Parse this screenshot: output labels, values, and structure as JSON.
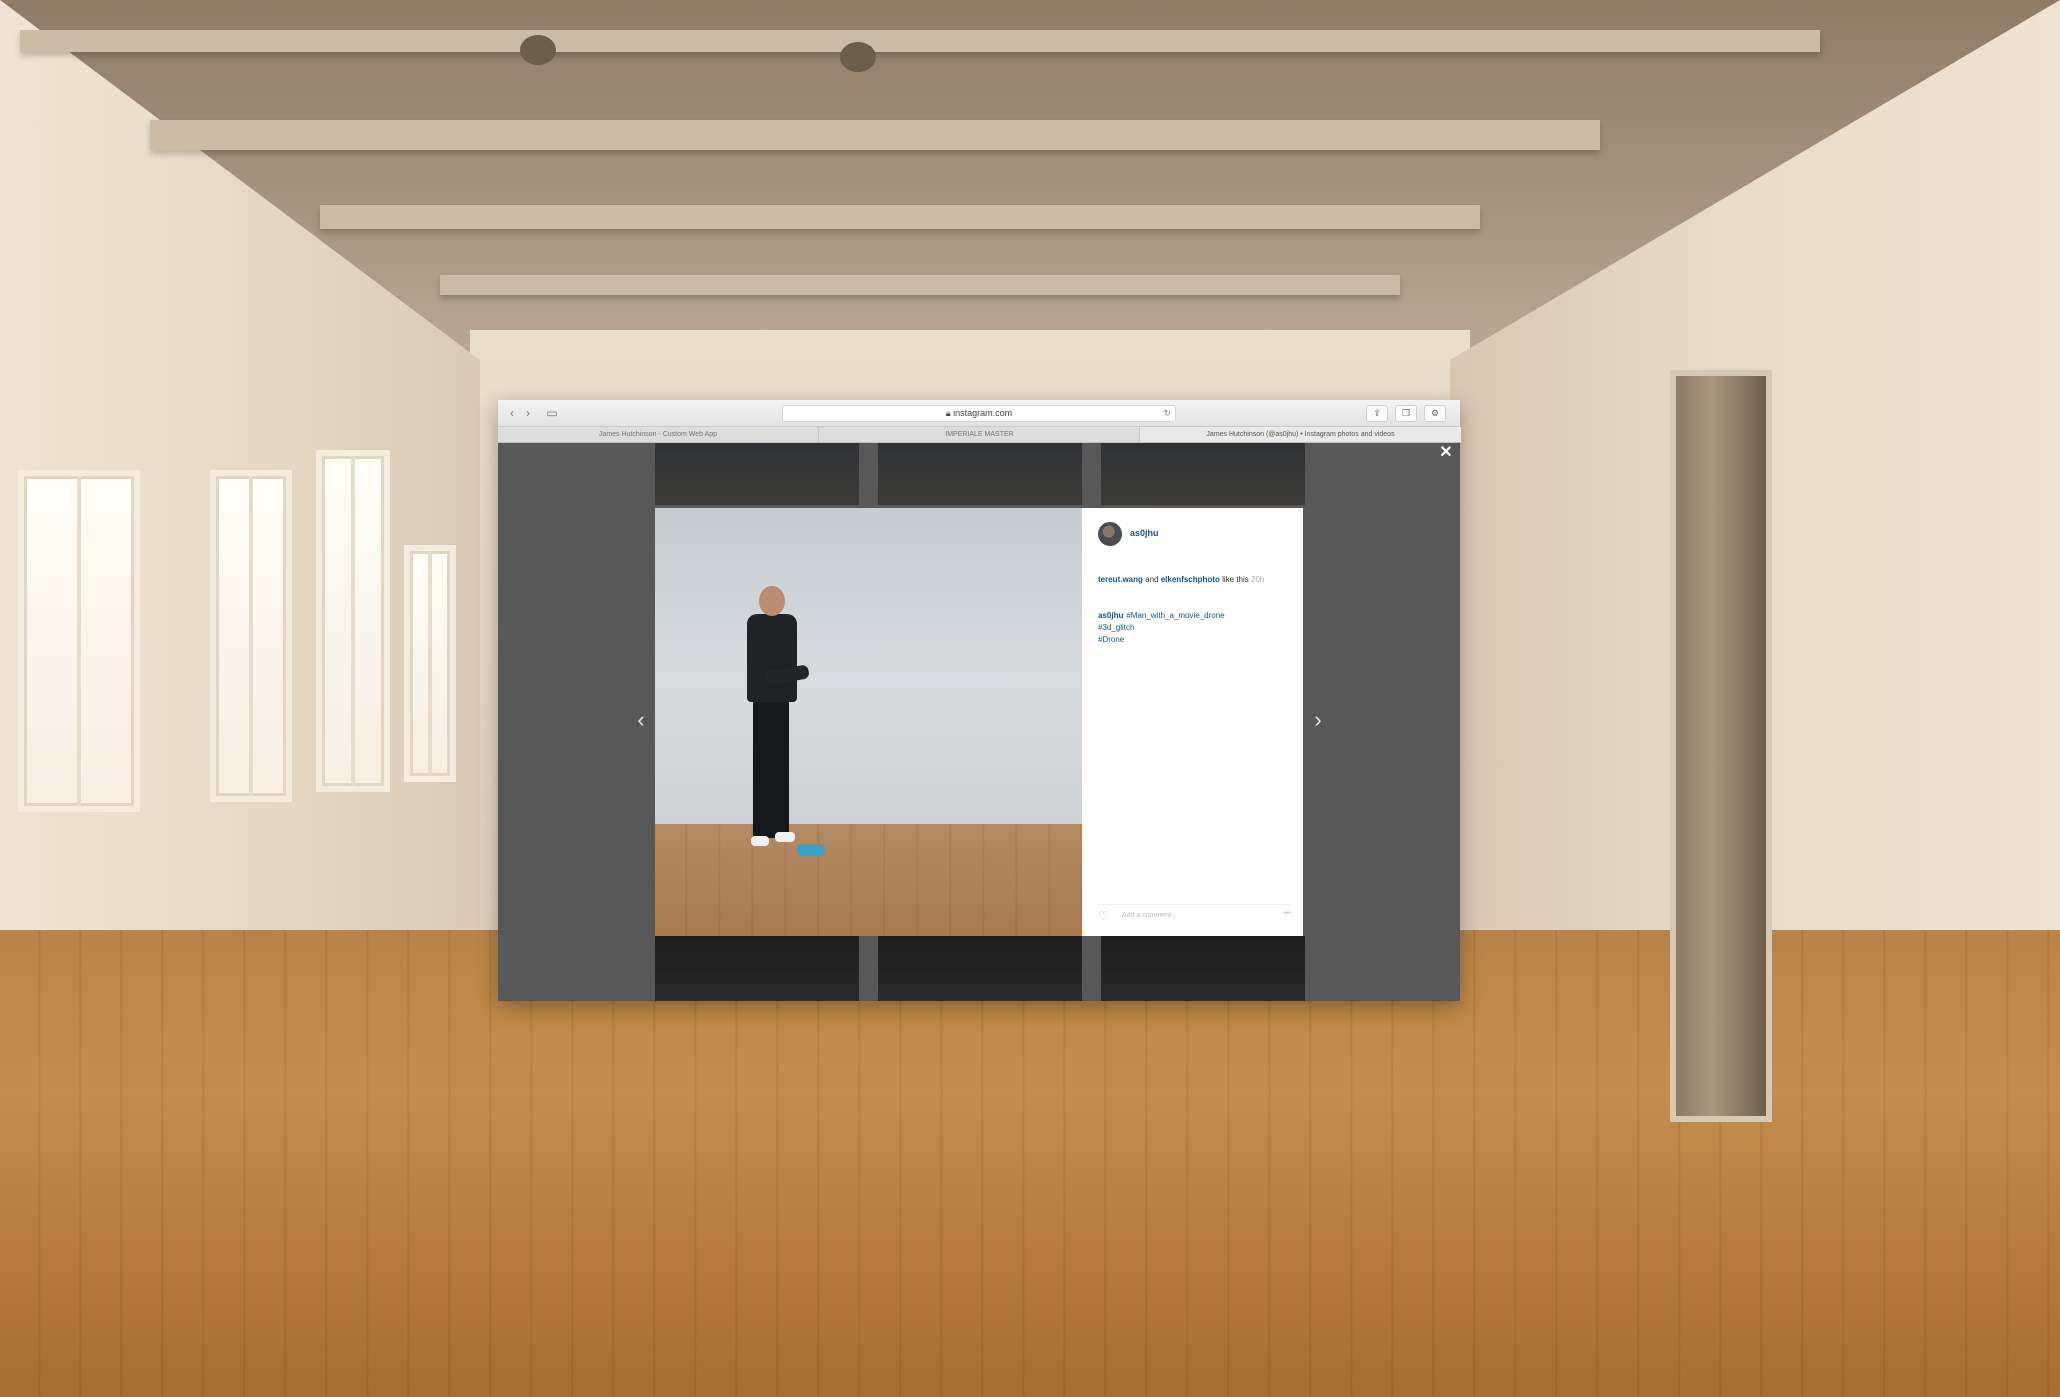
{
  "browser": {
    "url": "instagram.com",
    "tabs": [
      "James Hutchinson - Custom Web App",
      "IMPERIALE MASTER",
      "James Hutchinson (@as0jhu) • Instagram photos and videos"
    ],
    "icons": {
      "back": "chevron-left-icon",
      "forward": "chevron-right-icon",
      "sidebar": "sidebar-icon",
      "lock": "lock-icon",
      "reload": "reload-icon",
      "share": "share-icon",
      "tabs": "tabs-icon",
      "settings": "gear-icon"
    }
  },
  "post": {
    "username": "as0jhu",
    "likes": {
      "user1": "tereut.wang",
      "connector": "and",
      "user2": "elkenfschphoto",
      "suffix": "like this",
      "time": "20h"
    },
    "caption": {
      "username": "as0jhu",
      "tags": [
        "#Man_with_a_movie_drone",
        "#3d_glitch",
        "#Drone"
      ]
    },
    "comment_placeholder": "Add a comment...",
    "more_label": "•••"
  },
  "overlay": {
    "close_label": "✕",
    "prev_label": "‹",
    "next_label": "›"
  }
}
